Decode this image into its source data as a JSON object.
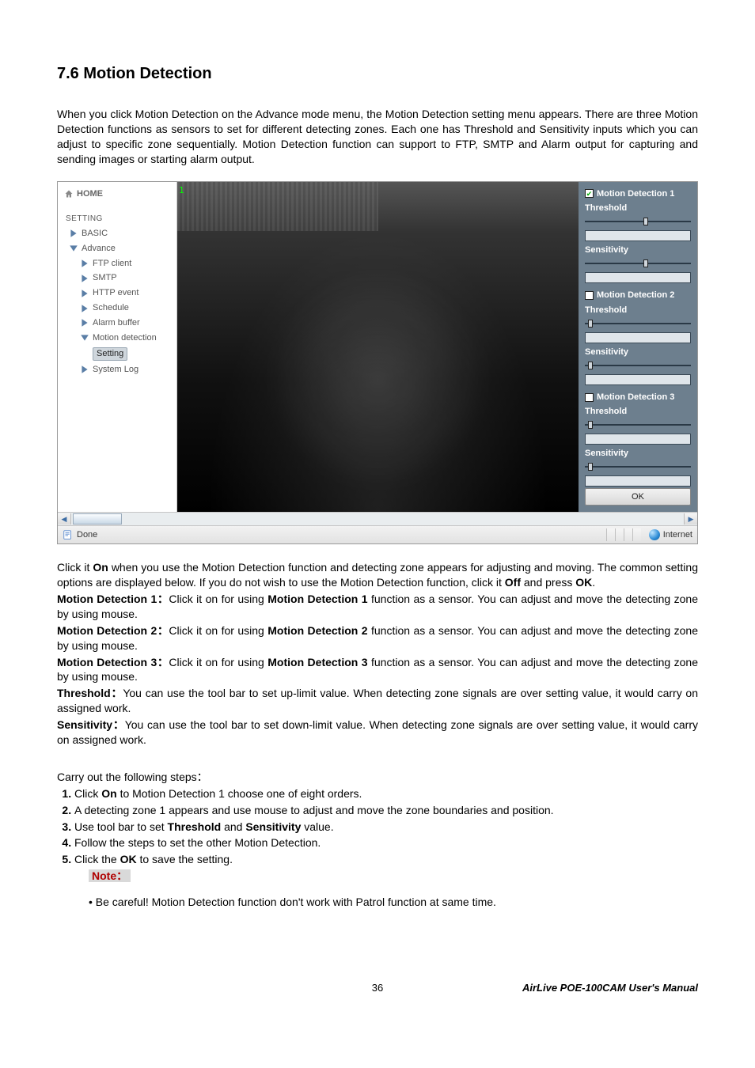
{
  "heading": "7.6 Motion Detection",
  "intro": "When you click Motion Detection on the Advance mode menu, the Motion Detection setting menu appears. There are three Motion Detection functions as sensors to set for different detecting zones. Each one has Threshold and Sensitivity inputs which you can adjust to specific zone sequentially. Motion Detection function can support to FTP, SMTP and Alarm output for capturing and sending images or starting alarm output.",
  "screenshot": {
    "sidebar": {
      "home": "HOME",
      "section_label": "SETTING",
      "items": [
        {
          "label": "BASIC",
          "depth": 1,
          "expand": "right"
        },
        {
          "label": "Advance",
          "depth": 1,
          "expand": "down"
        },
        {
          "label": "FTP client",
          "depth": 2,
          "expand": "right"
        },
        {
          "label": "SMTP",
          "depth": 2,
          "expand": "right"
        },
        {
          "label": "HTTP event",
          "depth": 2,
          "expand": "right"
        },
        {
          "label": "Schedule",
          "depth": 2,
          "expand": "right"
        },
        {
          "label": "Alarm buffer",
          "depth": 2,
          "expand": "right"
        },
        {
          "label": "Motion detection",
          "depth": 2,
          "expand": "down"
        },
        {
          "label": "Setting",
          "depth": 3,
          "selected": true
        },
        {
          "label": "System Log",
          "depth": 2,
          "expand": "right"
        }
      ]
    },
    "video_marker": "1",
    "panel": {
      "md1": {
        "title": "Motion Detection 1",
        "checked": true,
        "threshold_label": "Threshold",
        "threshold_pos": 0.55,
        "sensitivity_label": "Sensitivity",
        "sensitivity_pos": 0.55
      },
      "md2": {
        "title": "Motion Detection 2",
        "checked": false,
        "threshold_label": "Threshold",
        "threshold_pos": 0.05,
        "sensitivity_label": "Sensitivity",
        "sensitivity_pos": 0.05
      },
      "md3": {
        "title": "Motion Detection 3",
        "checked": false,
        "threshold_label": "Threshold",
        "threshold_pos": 0.05,
        "sensitivity_label": "Sensitivity",
        "sensitivity_pos": 0.05
      },
      "ok": "OK"
    },
    "statusbar": {
      "done": "Done",
      "zone": "Internet"
    }
  },
  "post1a": "Click it ",
  "post1b": "On",
  "post1c": " when you use the Motion Detection function and detecting zone appears for adjusting and moving. The common setting options are displayed below. If you do not wish to use the Motion Detection function, click it ",
  "post1d": "Off",
  "post1e": " and press ",
  "post1f": "OK",
  "post1g": ".",
  "md1a": "Motion Detection 1：",
  "md1b": "Click it on for using ",
  "md1c": "Motion Detection 1",
  "md1d": " function as a sensor. You can adjust and move the detecting zone by using mouse.",
  "md2a": "Motion Detection 2：",
  "md2b": "Click it on for using ",
  "md2c": "Motion Detection 2",
  "md2d": " function as a sensor. You can adjust and move the detecting zone by using mouse.",
  "md3a": "Motion Detection 3：",
  "md3b": "Click it on for using ",
  "md3c": "Motion Detection 3",
  "md3d": " function as a sensor. You can adjust and move the detecting zone by using mouse.",
  "th_a": "Threshold：",
  "th_b": "You can use the tool bar to set up-limit value. When detecting zone signals are over setting value, it would carry on assigned work.",
  "se_a": "Sensitivity：",
  "se_b": "You can use the tool bar to set down-limit value. When detecting zone signals are over setting value, it would carry on assigned work.",
  "carry": "Carry out the following steps：",
  "steps": {
    "s1a": "Click ",
    "s1b": "On",
    "s1c": " to Motion Detection 1 choose one of eight orders.",
    "s2": "A detecting zone 1 appears and use mouse to adjust and move the zone boundaries and position.",
    "s3a": "Use tool bar to set ",
    "s3b": "Threshold",
    "s3c": " and ",
    "s3d": "Sensitivity",
    "s3e": " value.",
    "s4": "Follow the steps to set the other Motion Detection.",
    "s5a": "Click the ",
    "s5b": "OK",
    "s5c": " to save the setting."
  },
  "note_label": "Note：",
  "note_text": "• Be careful! Motion Detection function don't work with Patrol function at same time.",
  "footer": {
    "page": "36",
    "manual": "AirLive  POE-100CAM  User's  Manual"
  }
}
